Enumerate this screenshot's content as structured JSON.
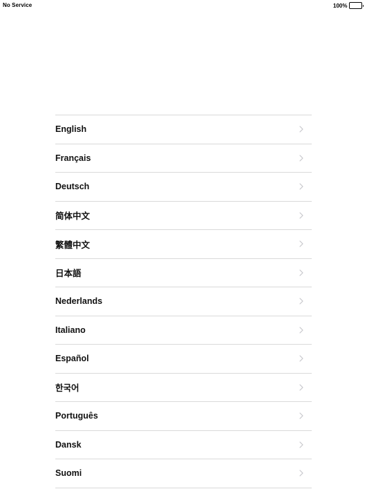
{
  "status_bar": {
    "carrier": "No Service",
    "battery_percent": "100%",
    "battery_level": 1.0
  },
  "languages": [
    {
      "label": "English",
      "icon": "chevron-right-icon"
    },
    {
      "label": "Français",
      "icon": "chevron-right-icon"
    },
    {
      "label": "Deutsch",
      "icon": "chevron-right-icon"
    },
    {
      "label": "简体中文",
      "icon": "chevron-right-icon"
    },
    {
      "label": "繁體中文",
      "icon": "chevron-right-icon"
    },
    {
      "label": "日本語",
      "icon": "chevron-right-icon"
    },
    {
      "label": "Nederlands",
      "icon": "chevron-right-icon"
    },
    {
      "label": "Italiano",
      "icon": "chevron-right-icon"
    },
    {
      "label": "Español",
      "icon": "chevron-right-icon"
    },
    {
      "label": "한국어",
      "icon": "chevron-right-icon"
    },
    {
      "label": "Português",
      "icon": "chevron-right-icon"
    },
    {
      "label": "Dansk",
      "icon": "chevron-right-icon"
    },
    {
      "label": "Suomi",
      "icon": "chevron-right-icon"
    }
  ],
  "colors": {
    "separator": "#d9d9d9",
    "chevron": "#c7c7cc",
    "text": "#111111"
  }
}
